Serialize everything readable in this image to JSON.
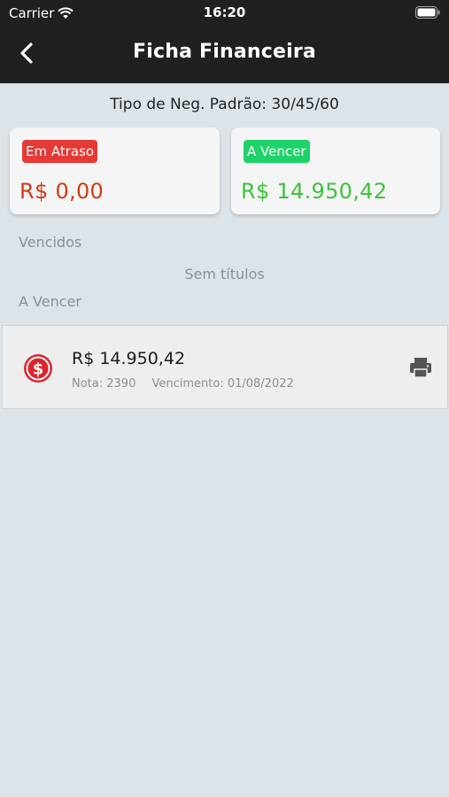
{
  "status_bar": {
    "carrier": "Carrier",
    "time": "16:20"
  },
  "header": {
    "title": "Ficha Financeira",
    "back_icon": "chevron-left-icon"
  },
  "subtitle": "Tipo de Neg. Padrão: 30/45/60",
  "summary": {
    "overdue": {
      "badge": "Em Atraso",
      "amount": "R$ 0,00",
      "badge_color": "#e53935",
      "amount_color": "#d23a13"
    },
    "upcoming": {
      "badge": "A Vencer",
      "amount": "R$ 14.950,42",
      "badge_color": "#1ed26a",
      "amount_color": "#3cc43b"
    }
  },
  "sections": {
    "vencidos": {
      "label": "Vencidos",
      "empty_message": "Sem títulos"
    },
    "a_vencer": {
      "label": "A Vencer"
    }
  },
  "titles": [
    {
      "amount": "R$ 14.950,42",
      "nota": "Nota: 2390",
      "vencimento": "Vencimento: 01/08/2022",
      "icon": "dollar-circle-icon",
      "action_icon": "printer-icon"
    }
  ]
}
